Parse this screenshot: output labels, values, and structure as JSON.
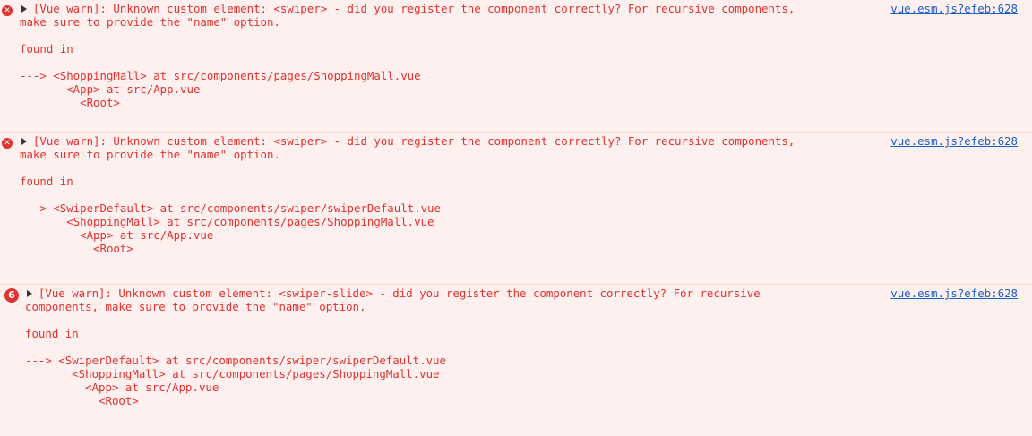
{
  "messages": [
    {
      "icon": "error-icon",
      "head": "  [Vue warn]: Unknown custom element: <swiper> - did you register the component correctly? For recursive components,",
      "lines": [
        "make sure to provide the \"name\" option.",
        "",
        "found in",
        "",
        "---> <ShoppingMall> at src/components/pages/ShoppingMall.vue",
        "       <App> at src/App.vue",
        "         <Root>"
      ],
      "source": "vue.esm.js?efeb:628"
    },
    {
      "icon": "error-icon",
      "head": "  [Vue warn]: Unknown custom element: <swiper> - did you register the component correctly? For recursive components,",
      "lines": [
        "make sure to provide the \"name\" option.",
        "",
        "found in",
        "",
        "---> <SwiperDefault> at src/components/swiper/swiperDefault.vue",
        "       <ShoppingMall> at src/components/pages/ShoppingMall.vue",
        "         <App> at src/App.vue",
        "           <Root>"
      ],
      "source": "vue.esm.js?efeb:628"
    },
    {
      "repeat_count": "6",
      "head": "  [Vue warn]: Unknown custom element: <swiper-slide> - did you register the component correctly? For recursive",
      "lines": [
        "components, make sure to provide the \"name\" option.",
        "",
        "found in",
        "",
        "---> <SwiperDefault> at src/components/swiper/swiperDefault.vue",
        "       <ShoppingMall> at src/components/pages/ShoppingMall.vue",
        "         <App> at src/App.vue",
        "           <Root>"
      ],
      "source": "vue.esm.js?efeb:628"
    }
  ],
  "colors": {
    "error_text": "#e0322f",
    "background": "#fff0f0",
    "link": "#1a5ec7"
  }
}
